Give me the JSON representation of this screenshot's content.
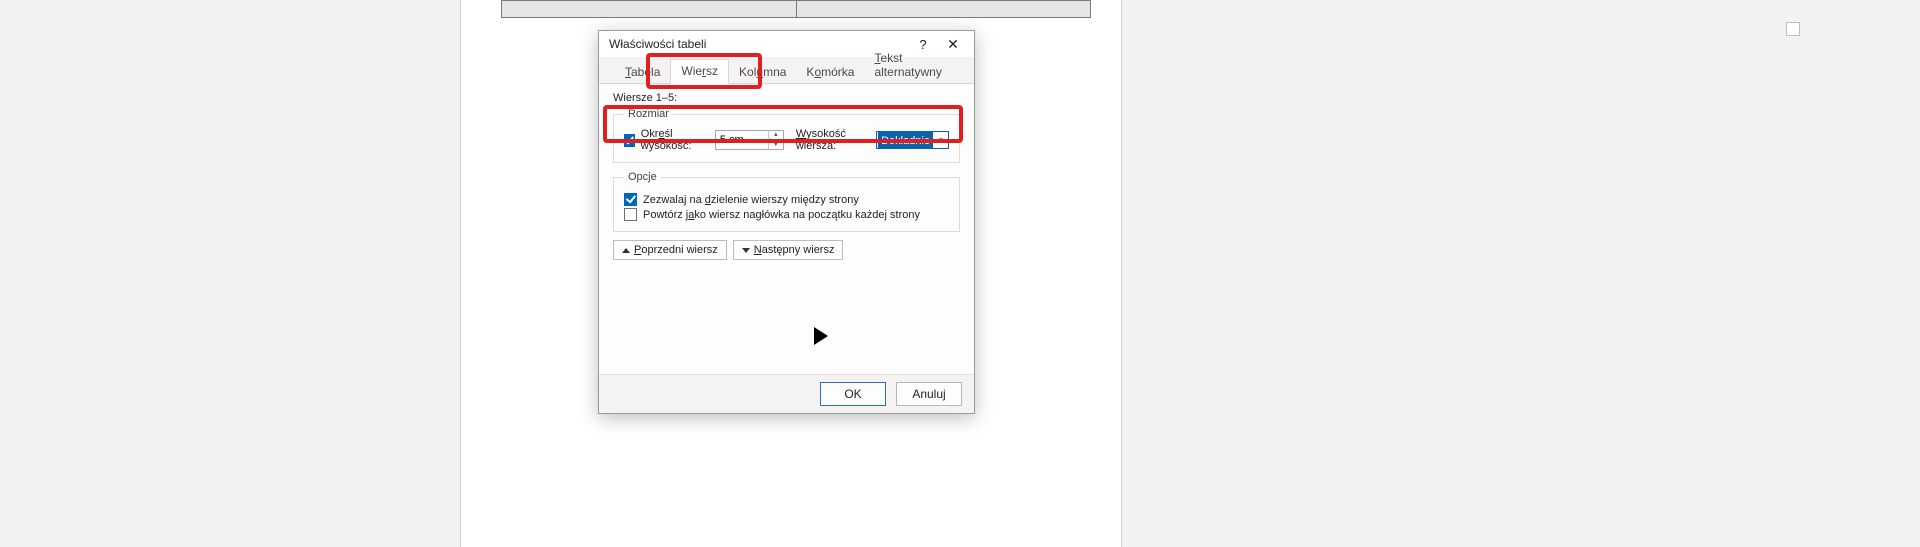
{
  "dialog": {
    "title": "Właściwości tabeli",
    "help_tooltip": "?",
    "close_tooltip": "✕"
  },
  "tabs": {
    "table": {
      "label_pre": "",
      "label_u": "T",
      "label_post": "abela"
    },
    "row": {
      "label_pre": "Wie",
      "label_u": "r",
      "label_post": "sz"
    },
    "column": {
      "label_pre": "Kol",
      "label_u": "u",
      "label_post": "mna"
    },
    "cell": {
      "label_pre": "K",
      "label_u": "o",
      "label_post": "mórka"
    },
    "alttext": {
      "label_pre": "",
      "label_u": "T",
      "label_post": "ekst alternatywny"
    }
  },
  "rows_label": "Wiersze 1–5:",
  "size": {
    "legend": "Rozmiar",
    "specify_height": {
      "pre": "Okr",
      "u": "e",
      "post": "śl wysokość:"
    },
    "height_value": "5 cm",
    "row_height_label": {
      "pre": "",
      "u": "W",
      "post": "ysokość wiersza:"
    },
    "row_height_mode": "Dokładnie"
  },
  "options": {
    "legend": "Opcje",
    "allow_break": {
      "pre": "Zezwalaj na ",
      "u": "d",
      "post": "zielenie wierszy między strony"
    },
    "repeat_header": {
      "pre": "Powtórz j",
      "u": "a",
      "post": "ko wiersz nagłówka na początku każdej strony"
    }
  },
  "nav": {
    "prev": {
      "pre": "",
      "u": "P",
      "post": "oprzedni wiersz"
    },
    "next": {
      "pre": "",
      "u": "N",
      "post": "astępny wiersz"
    }
  },
  "footer": {
    "ok": "OK",
    "cancel": "Anuluj"
  }
}
